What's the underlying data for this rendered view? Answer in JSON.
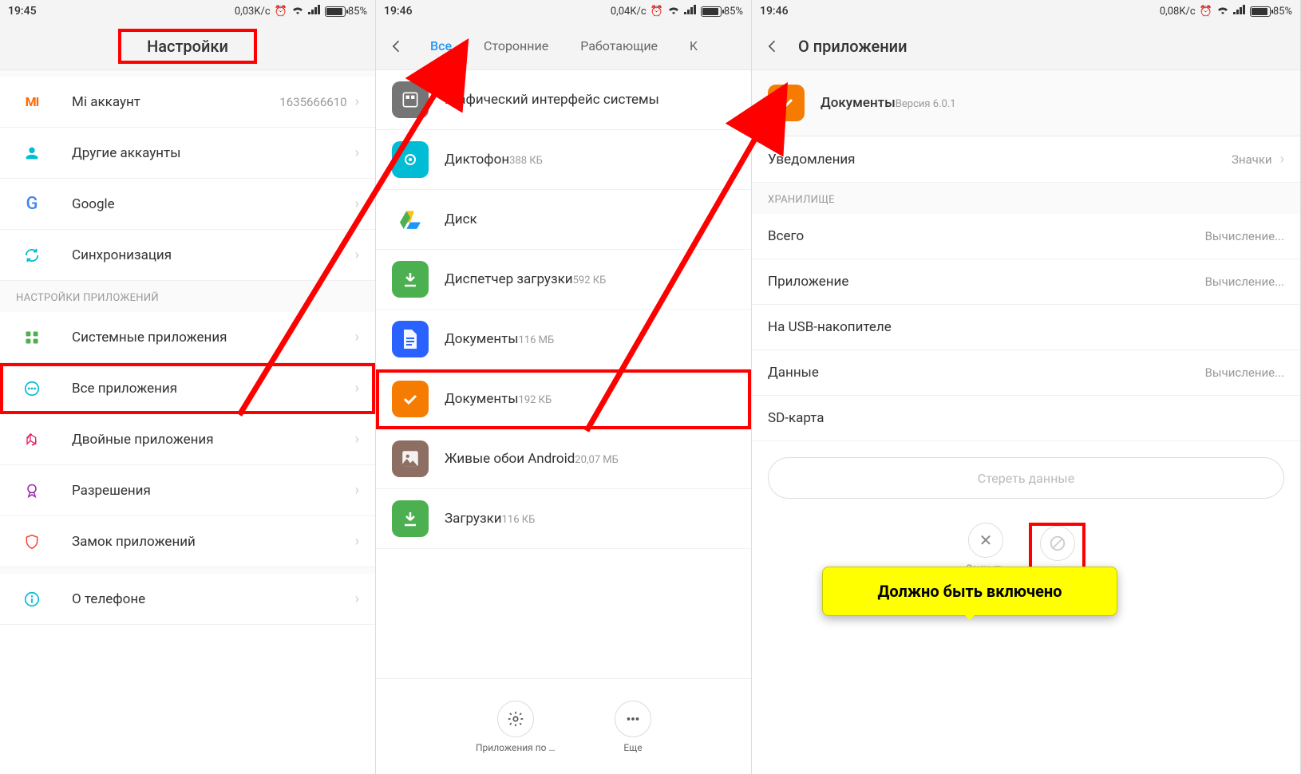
{
  "screen1": {
    "status": {
      "time": "19:45",
      "speed": "0,03K/c",
      "battery_pct": "85%"
    },
    "header_title": "Настройки",
    "rows": {
      "mi_account": {
        "title": "Mi аккаунт",
        "value": "1635666610"
      },
      "other_accounts": "Другие аккаунты",
      "google": "Google",
      "sync": "Синхронизация"
    },
    "section": "НАСТРОЙКИ ПРИЛОЖЕНИЙ",
    "rows2": {
      "system_apps": "Системные приложения",
      "all_apps": "Все приложения",
      "dual_apps": "Двойные приложения",
      "permissions": "Разрешения",
      "app_lock": "Замок приложений",
      "about": "О телефоне"
    }
  },
  "screen2": {
    "status": {
      "time": "19:46",
      "speed": "0,04K/c",
      "battery_pct": "85%"
    },
    "tabs": {
      "all": "Все",
      "third_party": "Сторонние",
      "running": "Работающие",
      "cached": "K"
    },
    "apps": {
      "system_ui": {
        "title": "Графический интерфейс системы",
        "sub": ""
      },
      "recorder": {
        "title": "Диктофон",
        "sub": "388 КБ"
      },
      "disk": {
        "title": "Диск",
        "sub": ""
      },
      "dl_mgr": {
        "title": "Диспетчер загрузки",
        "sub": "592 КБ"
      },
      "docs_g": {
        "title": "Документы",
        "sub": "116 МБ"
      },
      "docs": {
        "title": "Документы",
        "sub": "192 КБ"
      },
      "live_wp": {
        "title": "Живые обои Android",
        "sub": "20,07 МБ"
      },
      "downloads": {
        "title": "Загрузки",
        "sub": "116 КБ"
      }
    },
    "bottom": {
      "default_apps": "Приложения по умо...",
      "more": "Еще"
    }
  },
  "screen3": {
    "status": {
      "time": "19:46",
      "speed": "0,08K/c",
      "battery_pct": "85%"
    },
    "header_title": "О приложении",
    "app": {
      "name": "Документы",
      "version": "Версия 6.0.1"
    },
    "notifications": {
      "label": "Уведомления",
      "value": "Значки"
    },
    "storage_section": "ХРАНИЛИЩЕ",
    "storage": {
      "total": {
        "k": "Всего",
        "v": "Вычисление..."
      },
      "app": {
        "k": "Приложение",
        "v": "Вычисление..."
      },
      "usb": {
        "k": "На USB-накопителе",
        "v": ""
      },
      "data": {
        "k": "Данные",
        "v": "Вычисление..."
      },
      "sd": {
        "k": "SD-карта",
        "v": ""
      }
    },
    "clear_btn": "Стереть данные",
    "actions": {
      "close": "Закрыть",
      "disable": "Отключить"
    }
  },
  "callout_text": "Должно быть включено"
}
